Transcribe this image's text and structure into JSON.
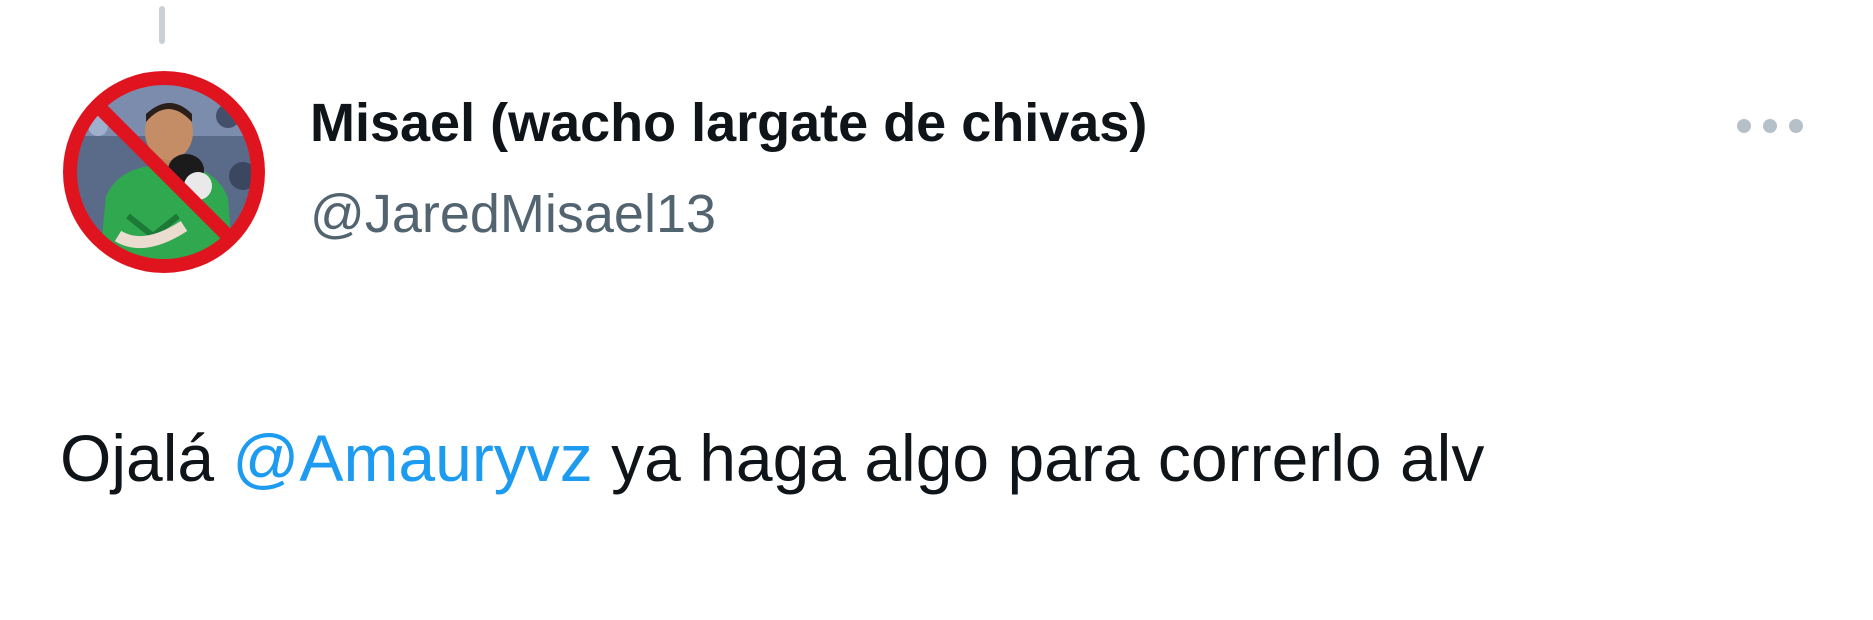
{
  "tweet": {
    "author": {
      "display_name": "Misael (wacho largate de chivas)",
      "handle": "@JaredMisael13"
    },
    "text": {
      "before_mention": "Ojalá ",
      "mention": "@Amauryvz",
      "after_mention": " ya haga algo para correrlo alv"
    }
  },
  "icons": {
    "more": "more-horizontal-icon",
    "avatar_overlay": "prohibited-icon"
  },
  "colors": {
    "text_primary": "#0f1419",
    "text_secondary": "#536471",
    "link": "#1d9bf0",
    "prohibit_red": "#e0141e",
    "kit_green": "#2fa84f"
  }
}
